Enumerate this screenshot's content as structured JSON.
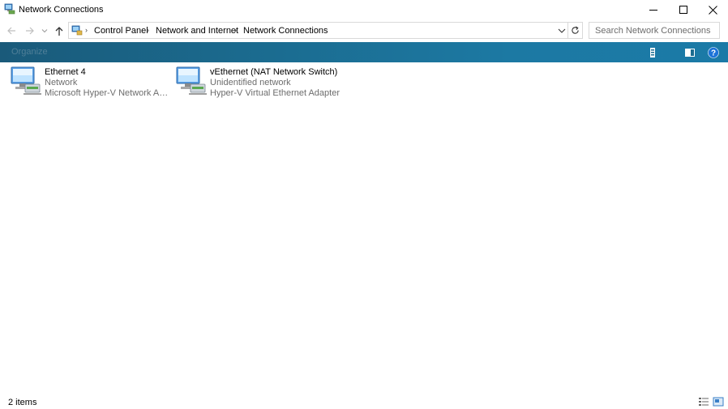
{
  "window": {
    "title": "Network Connections",
    "controls": [
      "minimize",
      "maximize",
      "close"
    ]
  },
  "navigation": {
    "breadcrumbs": [
      "Control Panel",
      "Network and Internet",
      "Network Connections"
    ],
    "search_placeholder": "Search Network Connections"
  },
  "toolbar": {
    "organize_label": "Organize"
  },
  "items": [
    {
      "name": "Ethernet 4",
      "status": "Network",
      "adapter": "Microsoft Hyper-V Network Adap..."
    },
    {
      "name": "vEthernet (NAT Network Switch)",
      "status": "Unidentified network",
      "adapter": "Hyper-V Virtual Ethernet Adapter"
    }
  ],
  "statusbar": {
    "count": "2 items"
  },
  "colors": {
    "command_bar": "#1b6b8f",
    "help_icon": "#1e73d8",
    "secondary_text": "#6d6d6d"
  }
}
